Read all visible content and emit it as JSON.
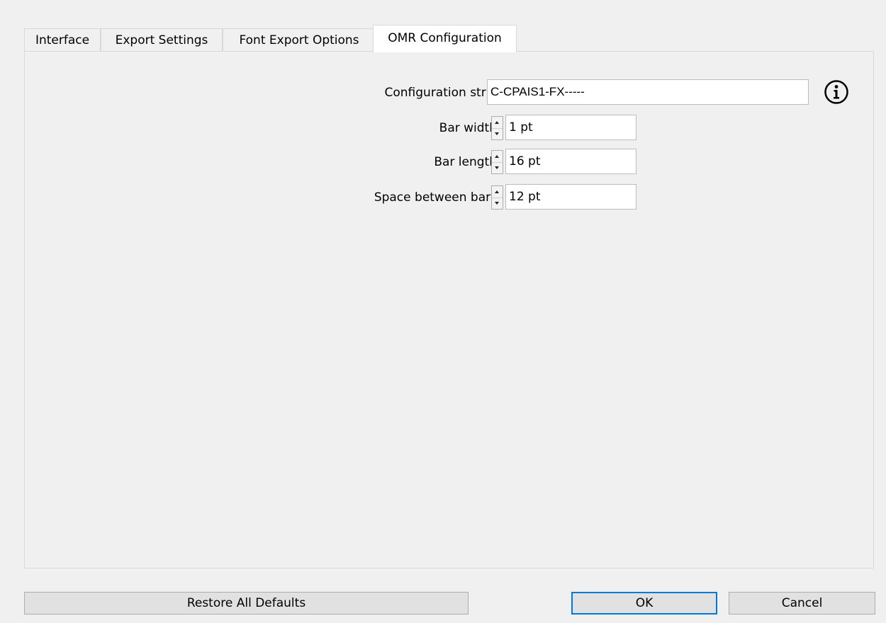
{
  "tabs": [
    {
      "label": "Interface",
      "active": false
    },
    {
      "label": "Export Settings",
      "active": false
    },
    {
      "label": "Font Export Options",
      "active": false
    },
    {
      "label": "OMR Configuration",
      "active": true
    }
  ],
  "omr": {
    "config_label": "Configuration string",
    "config_value": "C-CPAIS1-FX-----",
    "bar_width_label": "Bar width",
    "bar_width_value": "1 pt",
    "bar_length_label": "Bar length",
    "bar_length_value": "16 pt",
    "space_label": "Space between bars",
    "space_value": "12 pt",
    "info_icon": "info-circle-icon"
  },
  "buttons": {
    "restore": "Restore All Defaults",
    "ok": "OK",
    "cancel": "Cancel"
  },
  "colors": {
    "background": "#f0f0f0",
    "active_tab": "#ffffff",
    "default_button_border": "#0078d7"
  }
}
